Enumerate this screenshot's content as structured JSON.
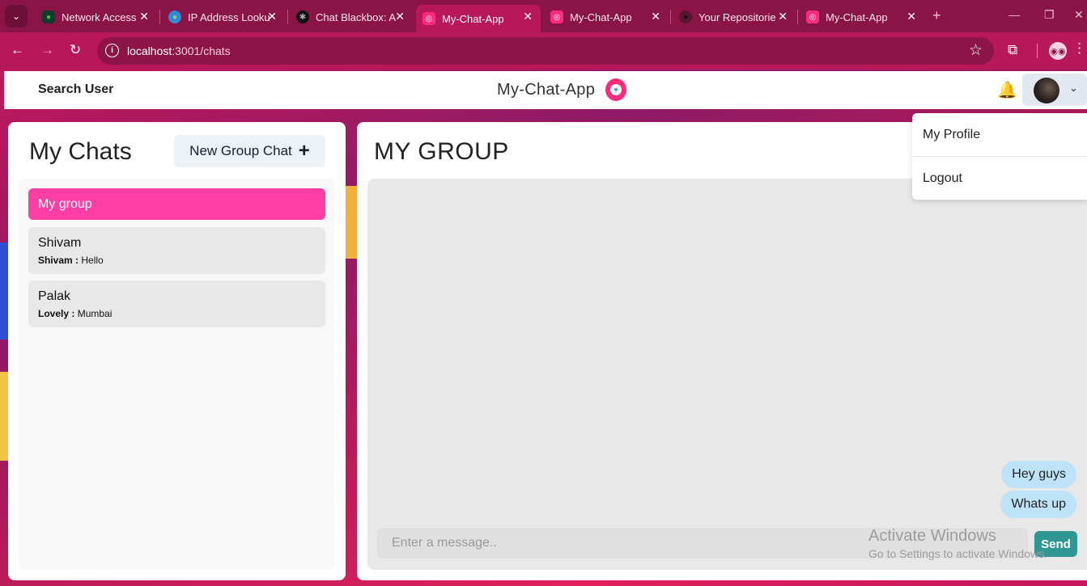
{
  "browser": {
    "tabs": [
      {
        "title": "Network Access",
        "icon": "mongodb-leaf-icon"
      },
      {
        "title": "IP Address Looku",
        "icon": "globe-icon"
      },
      {
        "title": "Chat Blackbox: A",
        "icon": "blackbox-icon"
      },
      {
        "title": "My-Chat-App",
        "icon": "chat-app-icon",
        "active": true
      },
      {
        "title": "My-Chat-App",
        "icon": "chat-app-icon"
      },
      {
        "title": "Your Repositorie",
        "icon": "github-icon"
      },
      {
        "title": "My-Chat-App",
        "icon": "chat-app-icon"
      }
    ],
    "url_host": "localhost",
    "url_path": ":3001/chats",
    "accent": "#b8185a"
  },
  "header": {
    "search_label": "Search User",
    "app_title": "My-Chat-App"
  },
  "user_menu": {
    "items": [
      "My Profile",
      "Logout"
    ]
  },
  "sidebar": {
    "title": "My Chats",
    "new_group_label": "New Group Chat",
    "chats": [
      {
        "name": "My group",
        "sender": "",
        "message": "",
        "selected": true
      },
      {
        "name": "Shivam",
        "sender": "Shivam :",
        "message": "Hello"
      },
      {
        "name": "Palak",
        "sender": "Lovely :",
        "message": "Mumbai"
      }
    ]
  },
  "chat": {
    "title": "MY GROUP",
    "messages": [
      "Hey guys",
      "Whats up"
    ],
    "input_placeholder": "Enter a message..",
    "send_label": "Send"
  },
  "watermark": {
    "line1": "Activate Windows",
    "line2": "Go to Settings to activate Windows."
  }
}
